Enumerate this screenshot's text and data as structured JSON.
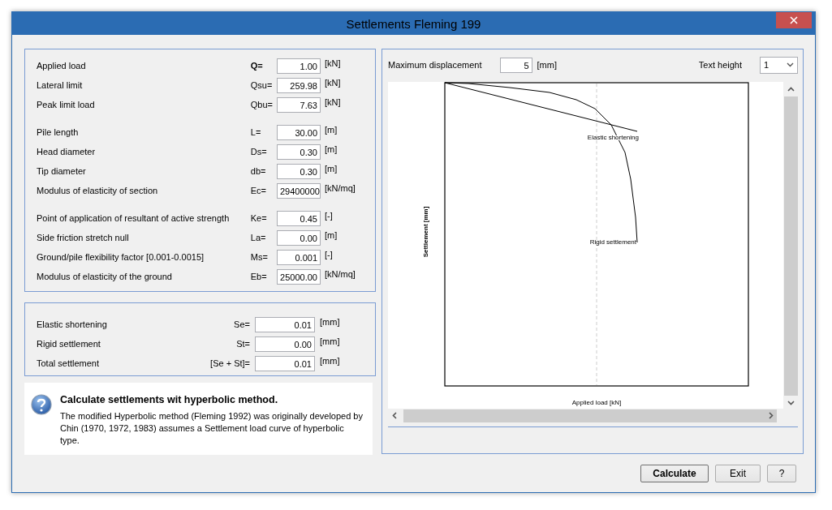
{
  "window": {
    "title": "Settlements Fleming 199"
  },
  "inputs": [
    [
      {
        "label": "Applied load",
        "symbol": "Q=",
        "bold": true,
        "value": "1.00",
        "unit": "[kN]"
      },
      {
        "label": "Lateral limit",
        "symbol": "Qsu=",
        "bold": false,
        "value": "259.98",
        "unit": "[kN]"
      },
      {
        "label": "Peak limit load",
        "symbol": "Qbu=",
        "bold": false,
        "value": "7.63",
        "unit": "[kN]"
      }
    ],
    [
      {
        "label": "Pile length",
        "symbol": "L=",
        "bold": false,
        "value": "30.00",
        "unit": "[m]"
      },
      {
        "label": "Head diameter",
        "symbol": "Ds=",
        "bold": false,
        "value": "0.30",
        "unit": "[m]"
      },
      {
        "label": "Tip diameter",
        "symbol": "db=",
        "bold": false,
        "value": "0.30",
        "unit": "[m]"
      },
      {
        "label": "Modulus of elasticity of section",
        "symbol": "Ec=",
        "bold": false,
        "value": "29400000",
        "unit": "[kN/mq]"
      }
    ],
    [
      {
        "label": "Point of application of resultant of active strength",
        "symbol": "Ke=",
        "bold": false,
        "value": "0.45",
        "unit": "[-]"
      },
      {
        "label": "Side friction stretch null",
        "symbol": "La=",
        "bold": false,
        "value": "0.00",
        "unit": "[m]"
      },
      {
        "label": "Ground/pile flexibility factor [0.001-0.0015]",
        "symbol": "Ms=",
        "bold": false,
        "value": "0.001",
        "unit": "[-]"
      },
      {
        "label": "Modulus of elasticity of the ground",
        "symbol": "Eb=",
        "bold": false,
        "value": "25000.00",
        "unit": "[kN/mq]"
      }
    ]
  ],
  "results": [
    {
      "label": "Elastic shortening",
      "symbol": "Se=",
      "value": "0.01",
      "unit": "[mm]"
    },
    {
      "label": "Rigid settlement",
      "symbol": "St=",
      "value": "0.00",
      "unit": "[mm]"
    },
    {
      "label": "Total settlement",
      "symbol": "[Se + St]=",
      "value": "0.01",
      "unit": "[mm]"
    }
  ],
  "help": {
    "title": "Calculate settlements wit hyperbolic method.",
    "text": "The modified Hyperbolic method (Fleming 1992) was originally developed by Chin (1970, 1972, 1983)  assumes a Settlement load curve of hyperbolic type."
  },
  "chart_panel": {
    "max_displacement": {
      "label": "Maximum displacement",
      "value": "5",
      "unit": "[mm]"
    },
    "text_height": {
      "label": "Text height",
      "value": "1"
    },
    "plot": {
      "y_label": "Settlement [mm]",
      "x_label": "Applied load [kN]",
      "curve_labels": [
        "Elastic shortening",
        "Rigid settlement"
      ]
    }
  },
  "buttons": [
    {
      "label": "Calculate",
      "default": true
    },
    {
      "label": "Exit",
      "default": false
    },
    {
      "label": "?",
      "default": false
    }
  ]
}
